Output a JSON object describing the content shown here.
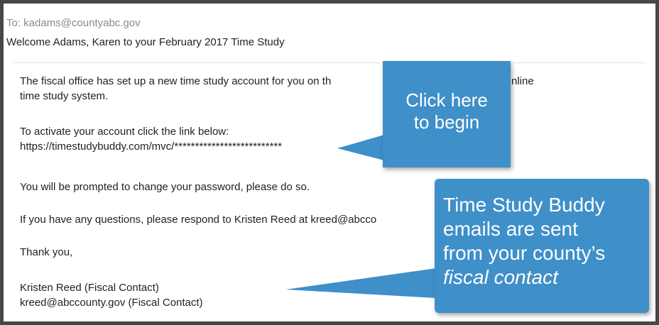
{
  "email": {
    "to": "To: kadams@countyabc.gov",
    "subject": "Welcome Adams, Karen to your February 2017 Time Study",
    "body": {
      "paragraph1_line1": "The fiscal office has set up a new time study account for you on th",
      "paragraph1_line1_end": "nline",
      "paragraph1_line2": "time study system.",
      "activate_line": "To activate your account click the link below:",
      "link": "https://timestudybuddy.com/mvc/**************************",
      "password_line": "You will be prompted to change your password, please do so.",
      "questions_line": "If you have any questions, please respond to Kristen Reed at kreed@abcco",
      "thanks": "Thank you,",
      "signature_name": "Kristen Reed (Fiscal Contact)",
      "signature_email": "kreed@abccounty.gov (Fiscal Contact)"
    }
  },
  "callouts": {
    "begin": {
      "line1": "Click here",
      "line2": "to begin"
    },
    "fiscal": {
      "line1": "Time Study Buddy",
      "line2": "emails are sent",
      "line3": "from your county’s",
      "line4_italic": "fiscal contact"
    }
  },
  "colors": {
    "frame": "#474747",
    "callout": "#3f8fc9",
    "to_text": "#8a8a8a",
    "body_text": "#222222"
  }
}
